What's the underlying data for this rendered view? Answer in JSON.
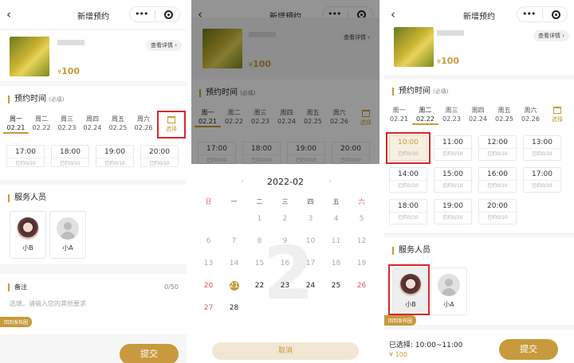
{
  "nav": {
    "title": "新增预约",
    "dots": "•••"
  },
  "product": {
    "currency": "¥",
    "price": "100",
    "detail": "查看详情 ›"
  },
  "booking": {
    "title": "预约时间",
    "required": "(必填)",
    "pick": "选择"
  },
  "days": [
    {
      "wd": "周一",
      "date": "02.21"
    },
    {
      "wd": "周二",
      "date": "02.22"
    },
    {
      "wd": "周三",
      "date": "02.23"
    },
    {
      "wd": "周四",
      "date": "02.24"
    },
    {
      "wd": "周五",
      "date": "02.25"
    },
    {
      "wd": "周六",
      "date": "02.26"
    }
  ],
  "slots_p1": [
    {
      "time": "17:00",
      "cap": "已约0/10"
    },
    {
      "time": "18:00",
      "cap": "已约0/10"
    },
    {
      "time": "19:00",
      "cap": "已约0/10"
    },
    {
      "time": "20:00",
      "cap": "已约0/10"
    }
  ],
  "slots_p3": [
    {
      "time": "10:00",
      "cap": "已约0/10"
    },
    {
      "time": "11:00",
      "cap": "已约0/10"
    },
    {
      "time": "12:00",
      "cap": "已约0/10"
    },
    {
      "time": "13:00",
      "cap": "已约0/10"
    },
    {
      "time": "14:00",
      "cap": "已约0/10"
    },
    {
      "time": "15:00",
      "cap": "已约0/10"
    },
    {
      "time": "16:00",
      "cap": "已约0/10"
    },
    {
      "time": "17:00",
      "cap": "已约0/10"
    },
    {
      "time": "18:00",
      "cap": "已约0/10"
    },
    {
      "time": "19:00",
      "cap": "已约0/10"
    },
    {
      "time": "20:00",
      "cap": "已约0/10"
    }
  ],
  "staff": {
    "title": "服务人员",
    "people": [
      "小B",
      "小A"
    ]
  },
  "note": {
    "title": "备注",
    "count": "0/50",
    "placeholder": "选填，请输入您的其他要求"
  },
  "tag": "回到发布圈",
  "submit": "提交",
  "calendar": {
    "month": "2022-02",
    "weekdays": [
      "日",
      "一",
      "二",
      "三",
      "四",
      "五",
      "六"
    ],
    "rows": [
      [
        "",
        "",
        "1",
        "2",
        "3",
        "4",
        "5"
      ],
      [
        "6",
        "7",
        "8",
        "9",
        "10",
        "11",
        "12"
      ],
      [
        "13",
        "14",
        "15",
        "16",
        "17",
        "18",
        "19"
      ],
      [
        "20",
        "21",
        "22",
        "23",
        "24",
        "25",
        "26"
      ],
      [
        "27",
        "28",
        "",
        "",
        "",
        "",
        ""
      ]
    ],
    "cancel": "取消"
  },
  "summary": {
    "label": "已选择:",
    "range": "10:00~11:00",
    "price": "¥ 100"
  }
}
